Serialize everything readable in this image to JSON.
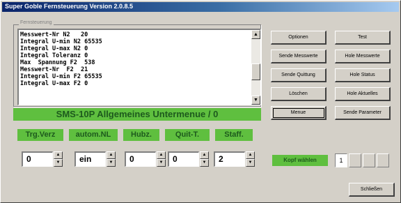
{
  "window": {
    "title": "Super Goble Fernsteuerung Version 2.0.8.5"
  },
  "log": {
    "group_label": "Fernsteuerung",
    "lines": [
      "Messwert-Nr N2   20",
      "Integral U-min N2 65535",
      "Integral U-max N2 0",
      "Integral Toleranz 0",
      "Max  Spannung F2  538",
      "Messwert-Nr  F2  21",
      "Integral U-min F2 65535",
      "Integral U-max F2 0"
    ]
  },
  "menu_banner": "SMS-10P Allgemeines Untermenue / 0",
  "params": [
    {
      "label": "Trg.Verz",
      "value": "0"
    },
    {
      "label": "autom.NL",
      "value": "ein"
    },
    {
      "label": "Hubz.",
      "value": "0"
    },
    {
      "label": "Quit-T.",
      "value": "0"
    },
    {
      "label": "Staff.",
      "value": "2"
    }
  ],
  "buttons": {
    "optionen": "Optionen",
    "test": "Test",
    "sende_messwerte": "Sende Messwerte",
    "hole_messwerte": "Hole Messwerte",
    "sende_quittung": "Sende Quittung",
    "hole_status": "Hole Status",
    "loeschen": "Löschen",
    "hole_aktuelles": "Hole Aktuelles",
    "menue": "Menue",
    "sende_parameter": "Sende Parameter",
    "schliessen": "Schließen"
  },
  "kopf": {
    "label": "Kopf wählen",
    "options": [
      "1",
      "",
      "",
      ""
    ]
  }
}
